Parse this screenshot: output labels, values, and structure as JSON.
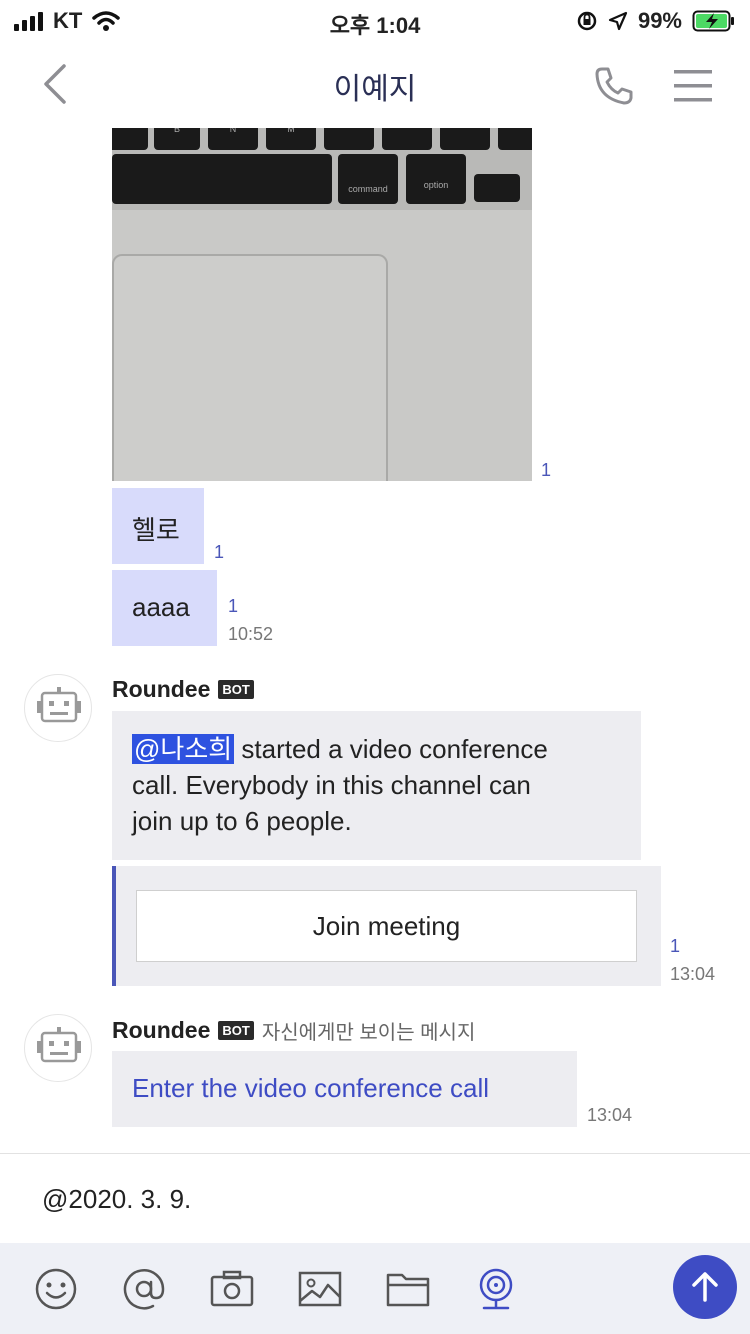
{
  "status_bar": {
    "carrier": "KT",
    "time": "오후 1:04",
    "battery": "99%"
  },
  "header": {
    "title": "이예지"
  },
  "photo": {
    "keys": [
      "B",
      "N",
      "M",
      "command",
      "option"
    ],
    "read_count": "1"
  },
  "my_messages": [
    {
      "text": "헬로",
      "read_count": "1"
    },
    {
      "text": "aaaa",
      "read_count": "1",
      "time": "10:52"
    }
  ],
  "bot_message_1": {
    "sender": "Roundee",
    "badge": "BOT",
    "mention": "@나소희",
    "line1_rest": " started a video conference",
    "line2": "call. Everybody in this channel can",
    "line3": "join up to 6 people.",
    "button_label": "Join meeting",
    "read_count": "1",
    "time": "13:04"
  },
  "bot_message_2": {
    "sender": "Roundee",
    "badge": "BOT",
    "visibility_note": "자신에게만 보이는 메시지",
    "link_text": "Enter the video conference call",
    "time": "13:04"
  },
  "composer": {
    "value": "@2020. 3. 9."
  },
  "toolbar": {
    "tools": [
      "emoji-icon",
      "mention-icon",
      "camera-icon",
      "image-icon",
      "folder-icon",
      "webcam-icon"
    ],
    "send": "send-arrow-icon"
  },
  "colors": {
    "accent": "#3e4cc4",
    "my_bubble": "#d8dbfb",
    "bot_bubble": "#ededf1",
    "toolbar_bg": "#eef0f6"
  }
}
